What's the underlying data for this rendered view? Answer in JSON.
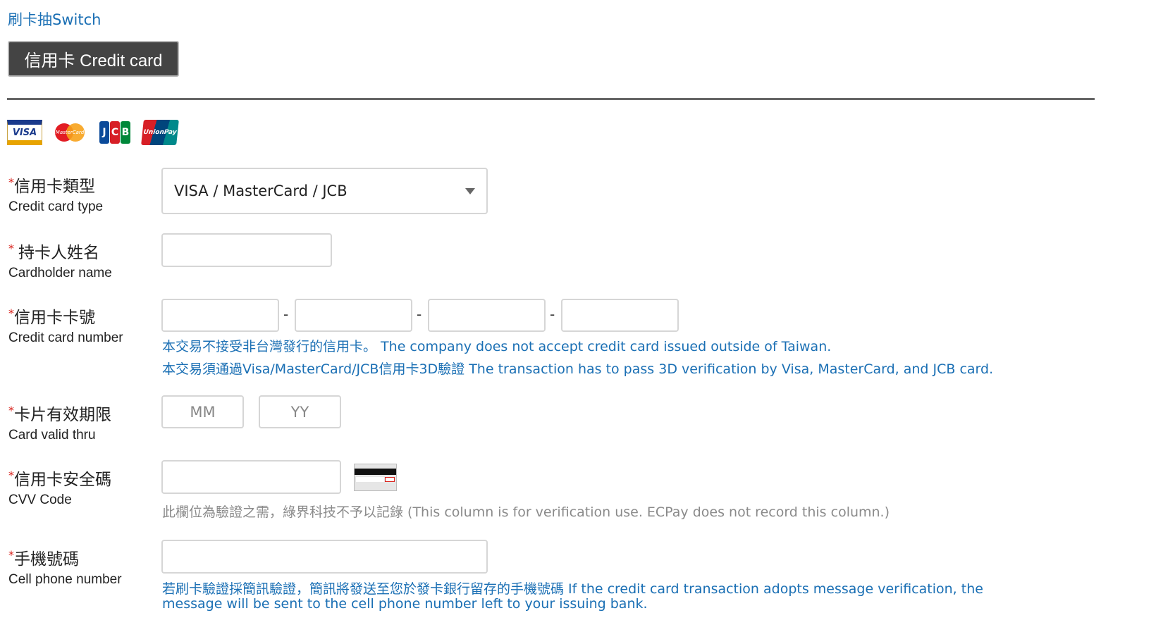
{
  "header": {
    "switch_link": "刷卡抽Switch",
    "tab_credit_card": "信用卡 Credit card"
  },
  "card_logos": {
    "visa": "VISA",
    "mastercard": "MasterCard",
    "jcb": [
      "J",
      "C",
      "B"
    ],
    "unionpay": "UnionPay"
  },
  "form": {
    "required_mark": "*",
    "card_type": {
      "label_zh": "信用卡類型",
      "label_en": "Credit card type",
      "selected": "VISA / MasterCard / JCB"
    },
    "cardholder": {
      "label_zh": "持卡人姓名",
      "label_en": "Cardholder name",
      "value": ""
    },
    "card_number": {
      "label_zh": "信用卡卡號",
      "label_en": "Credit card number",
      "separator": "-",
      "segments": [
        "",
        "",
        "",
        ""
      ],
      "note1": "本交易不接受非台灣發行的信用卡。 The company does not accept credit card issued outside of Taiwan.",
      "note2": "本交易須通過Visa/MasterCard/JCB信用卡3D驗證 The transaction has to pass 3D verification by Visa, MasterCard, and JCB card."
    },
    "valid_thru": {
      "label_zh": "卡片有效期限",
      "label_en": "Card valid thru",
      "month_placeholder": "MM",
      "year_placeholder": "YY"
    },
    "cvv": {
      "label_zh": "信用卡安全碼",
      "label_en": "CVV Code",
      "value": "",
      "note": "此欄位為驗證之需，綠界科技不予以記錄 (This column is for verification use. ECPay does not record this column.)"
    },
    "phone": {
      "label_zh": "手機號碼",
      "label_en": "Cell phone number",
      "value": "",
      "note_line1": "若刷卡驗證採簡訊驗證，簡訊將發送至您於發卡銀行留存的手機號碼 If the credit card transaction adopts message verification, the",
      "note_line2": "message will be sent to the cell phone number left to your issuing bank."
    }
  },
  "colors": {
    "link_blue": "#1a6fb4",
    "required_red": "#d9231d",
    "tab_bg": "#444444"
  }
}
